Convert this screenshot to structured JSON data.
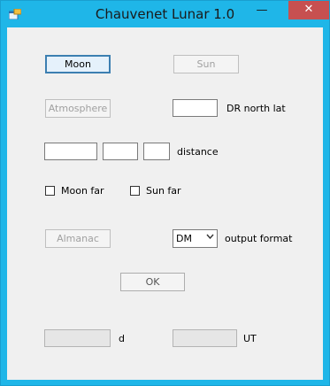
{
  "window": {
    "title": "Chauvenet Lunar 1.0",
    "controls": {
      "minimize": "—",
      "maximize": "□",
      "close": "✕"
    }
  },
  "buttons": {
    "moon": "Moon",
    "sun": "Sun",
    "atmosphere": "Atmosphere",
    "almanac": "Almanac",
    "ok": "OK"
  },
  "fields": {
    "dr_north_lat": {
      "label": "DR north lat",
      "value": ""
    },
    "distance": {
      "label": "distance",
      "values": [
        "",
        "",
        ""
      ]
    },
    "result_d": {
      "label": "d",
      "value": ""
    },
    "result_ut": {
      "label": "UT",
      "value": ""
    }
  },
  "checkboxes": {
    "moon_far": {
      "label": "Moon far",
      "checked": false
    },
    "sun_far": {
      "label": "Sun far",
      "checked": false
    }
  },
  "output_format": {
    "label": "output format",
    "selected": "DM"
  },
  "colors": {
    "titlebar": "#1fb6e8",
    "close_button": "#c75050",
    "client_background": "#f0f0f0"
  }
}
